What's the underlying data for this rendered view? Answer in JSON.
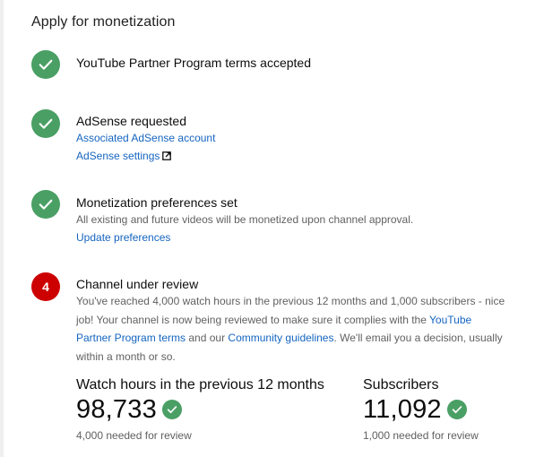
{
  "header": {
    "title": "Apply for monetization"
  },
  "steps": [
    {
      "status": "done",
      "title": "YouTube Partner Program terms accepted"
    },
    {
      "status": "done",
      "title": "AdSense requested",
      "links": [
        "Associated AdSense account",
        "AdSense settings"
      ]
    },
    {
      "status": "done",
      "title": "Monetization preferences set",
      "description": "All existing and future videos will be monetized upon channel approval.",
      "links": [
        "Update preferences"
      ]
    },
    {
      "status": "in-review",
      "number": "4",
      "title": "Channel under review",
      "description_part1": "You've reached 4,000 watch hours in the previous 12 months and 1,000 subscribers - nice job! Your channel is now being reviewed to make sure it complies with the ",
      "link_terms": "YouTube Partner Program terms",
      "description_part2": " and our ",
      "link_guidelines": "Community guidelines",
      "description_part3": ". We'll email you a decision, usually within a month or so."
    }
  ],
  "stats": [
    {
      "label": "Watch hours in the previous 12 months",
      "value": "98,733",
      "note": "4,000 needed for review"
    },
    {
      "label": "Subscribers",
      "value": "11,092",
      "note": "1,000 needed for review"
    }
  ],
  "colors": {
    "success": "#4a9f64",
    "error": "#cc0000",
    "link": "#1565c0",
    "secondary_text": "#616161"
  },
  "icons": {
    "done": "check-icon",
    "external": "external-link-icon"
  }
}
